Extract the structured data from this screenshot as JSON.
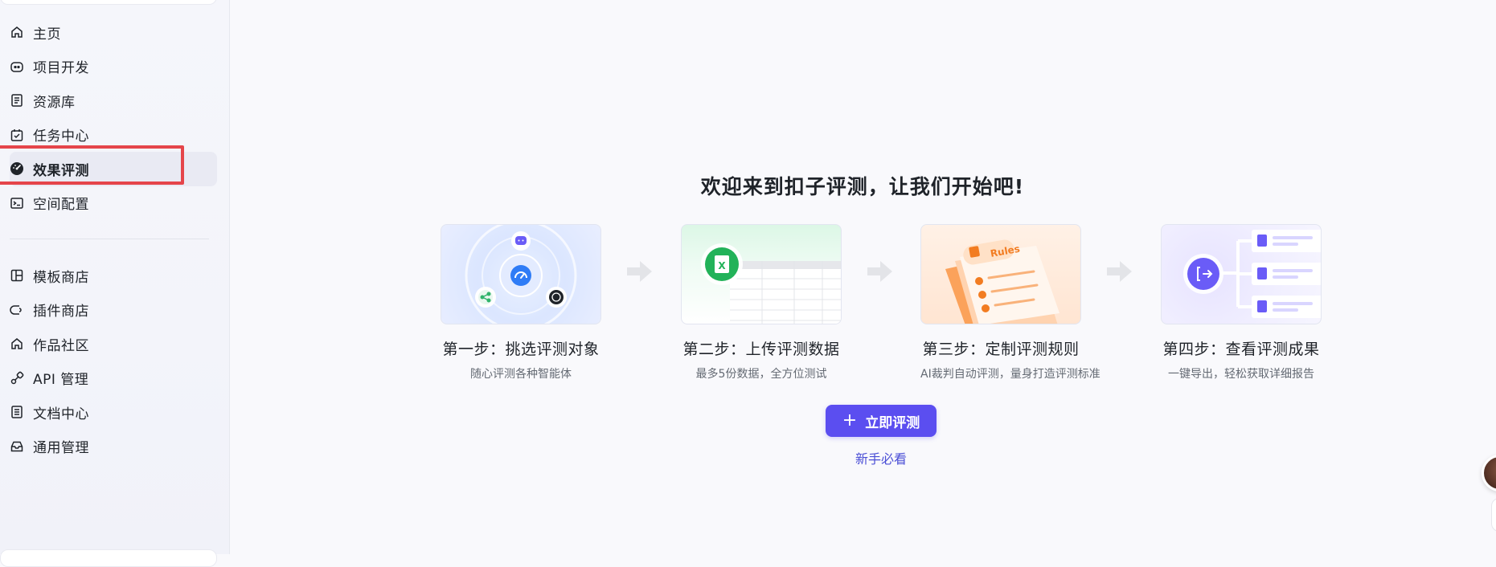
{
  "sidebar": {
    "items": [
      {
        "label": "主页",
        "icon": "home-icon"
      },
      {
        "label": "项目开发",
        "icon": "bot-icon"
      },
      {
        "label": "资源库",
        "icon": "library-icon"
      },
      {
        "label": "任务中心",
        "icon": "task-icon"
      },
      {
        "label": "效果评测",
        "icon": "gauge-icon",
        "active": true
      },
      {
        "label": "空间配置",
        "icon": "terminal-icon"
      }
    ],
    "items2": [
      {
        "label": "模板商店",
        "icon": "template-icon"
      },
      {
        "label": "插件商店",
        "icon": "plugin-icon"
      },
      {
        "label": "作品社区",
        "icon": "community-icon"
      },
      {
        "label": "API 管理",
        "icon": "api-icon"
      },
      {
        "label": "文档中心",
        "icon": "doc-icon"
      },
      {
        "label": "通用管理",
        "icon": "inbox-icon"
      }
    ]
  },
  "main": {
    "title": "欢迎来到扣子评测，让我们开始吧!",
    "steps": [
      {
        "title": "第一步：挑选评测对象",
        "subtitle": "随心评测各种智能体"
      },
      {
        "title": "第二步：上传评测数据",
        "subtitle": "最多5份数据，全方位测试"
      },
      {
        "title": "第三步：定制评测规则",
        "subtitle": "AI裁判自动评测，量身打造评测标准"
      },
      {
        "title": "第四步：查看评测成果",
        "subtitle": "一键导出，轻松获取详细报告"
      }
    ],
    "rules_badge": "Rules",
    "cta_label": "立即评测",
    "guide_link": "新手必看"
  },
  "colors": {
    "accent": "#5b4ef0",
    "link": "#4b4fd6",
    "highlight": "#e5454a"
  }
}
